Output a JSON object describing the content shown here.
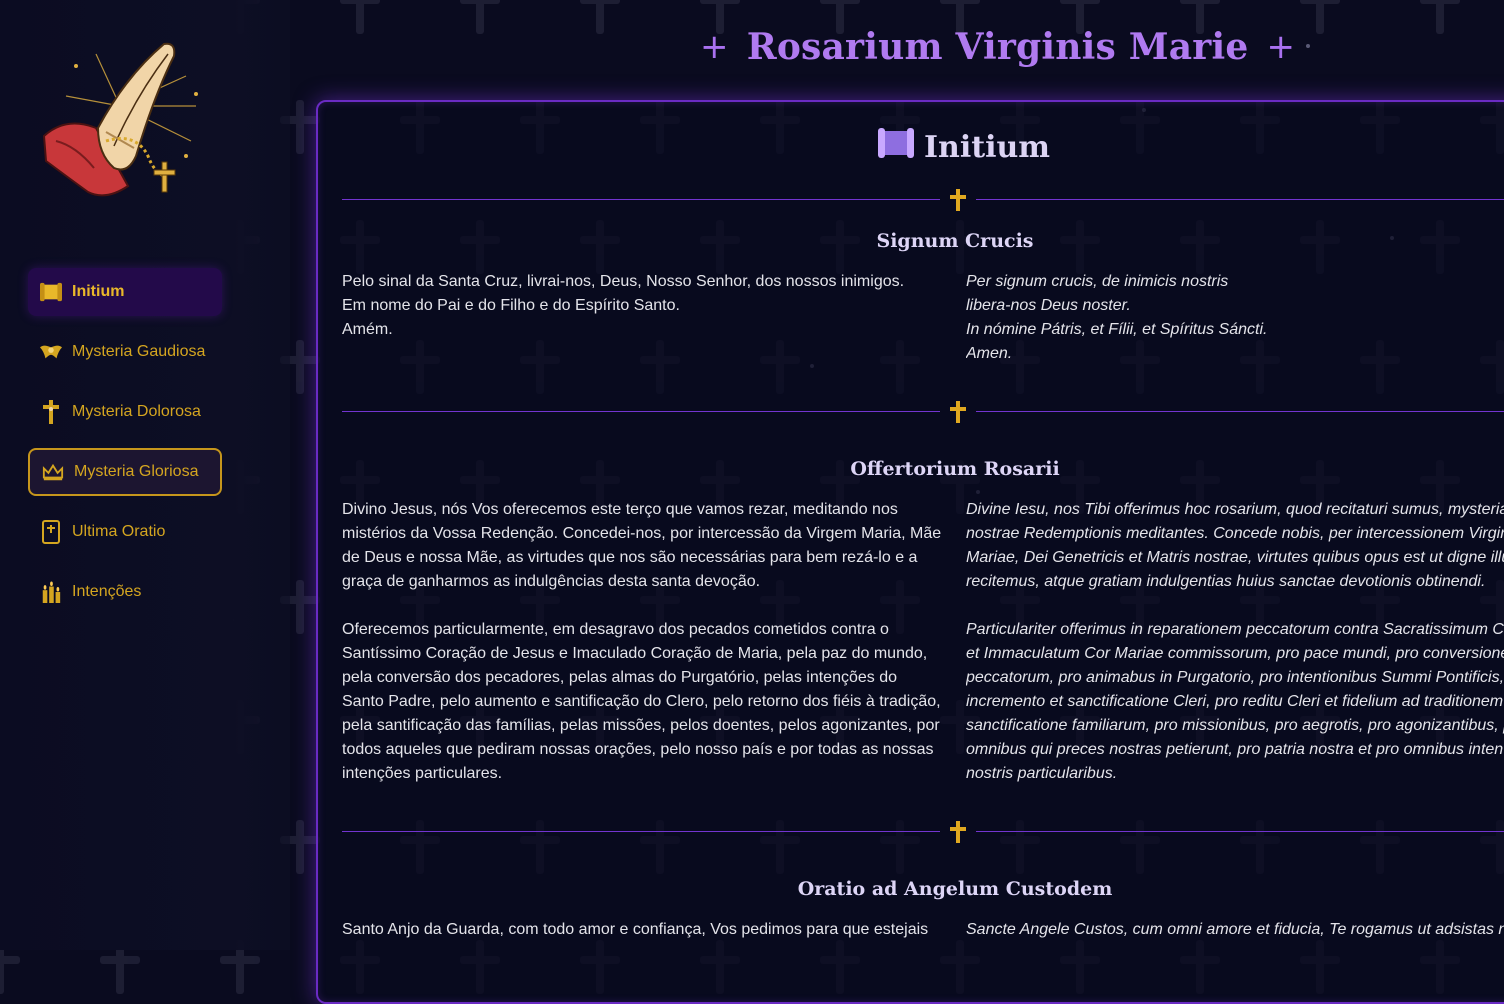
{
  "header": {
    "title": "Rosarium Virginis Marie"
  },
  "sidebar": {
    "logo": "praying-hands-rosary-icon",
    "items": [
      {
        "label": "Initium",
        "icon": "scroll-icon",
        "state": "active"
      },
      {
        "label": "Mysteria Gaudiosa",
        "icon": "angel-wings-icon",
        "state": "normal"
      },
      {
        "label": "Mysteria Dolorosa",
        "icon": "crucifix-icon",
        "state": "normal"
      },
      {
        "label": "Mysteria Gloriosa",
        "icon": "crown-icon",
        "state": "focused"
      },
      {
        "label": "Ultima Oratio",
        "icon": "prayer-book-icon",
        "state": "normal"
      },
      {
        "label": "Intenções",
        "icon": "candles-icon",
        "state": "normal"
      }
    ]
  },
  "main": {
    "section_title": "Initium",
    "section_icon": "scroll-icon",
    "prayers": [
      {
        "title": "Signum Crucis",
        "pt": [
          "Pelo sinal da Santa Cruz, livrai-nos, Deus, Nosso Senhor, dos nossos inimigos.\nEm nome do Pai e do Filho e do Espírito Santo.\nAmém."
        ],
        "la": [
          "Per signum crucis, de inimicis nostris\nlibera-nos Deus noster.\nIn nómine Pátris, et Fílii, et Spíritus Sáncti.\nAmen."
        ]
      },
      {
        "title": "Offertorium Rosarii",
        "pt": [
          "Divino Jesus, nós Vos oferecemos este terço que vamos rezar, meditando nos\nmistérios da Vossa Redenção. Concedei-nos, por intercessão da Virgem Maria, Mãe\nde Deus e nossa Mãe, as virtudes que nos são necessárias para bem rezá-lo e a\ngraça de ganharmos as indulgências desta santa devoção.",
          "Oferecemos particularmente, em desagravo dos pecados cometidos contra o\nSantíssimo Coração de Jesus e Imaculado Coração de Maria, pela paz do mundo,\npela conversão dos pecadores, pelas almas do Purgatório, pelas intenções do\nSanto Padre, pelo aumento e santificação do Clero, pelo retorno dos fiéis à tradição,\npela santificação das famílias, pelas missões, pelos doentes, pelos agonizantes, por\ntodos aqueles que pediram nossas orações, pelo nosso país e por todas as nossas\nintenções particulares."
        ],
        "la": [
          "Divine Iesu, nos Tibi offerimus hoc rosarium, quod recitaturi sumus, mysteria\nnostrae Redemptionis meditantes. Concede nobis, per intercessionem Virgin\nMariae, Dei Genetricis et Matris nostrae, virtutes quibus opus est ut digne illu\nrecitemus, atque gratiam indulgentias huius sanctae devotionis obtinendi.",
          "Particulariter offerimus in reparationem peccatorum contra Sacratissimum Co\net Immaculatum Cor Mariae commissorum, pro pace mundi, pro conversione\npeccatorum, pro animabus in Purgatorio, pro intentionibus Summi Pontificis,\nincremento et sanctificatione Cleri, pro reditu Cleri et fidelium ad traditionem\nsanctificatione familiarum, pro missionibus, pro aegrotis, pro agonizantibus, p\nomnibus qui preces nostras petierunt, pro patria nostra et pro omnibus intent\nnostris particularibus."
        ]
      },
      {
        "title": "Oratio ad Angelum Custodem",
        "pt": [
          "Santo Anjo da Guarda, com todo amor e confiança, Vos pedimos para que estejais"
        ],
        "la": [
          "Sancte Angele Custos, cum omni amore et fiducia, Te rogamus ut adsistas n"
        ]
      }
    ]
  },
  "colors": {
    "accent": "#b07af0",
    "gold": "#d4a520",
    "panel_border": "#6a2bc4",
    "background": "#0a0b1f"
  }
}
